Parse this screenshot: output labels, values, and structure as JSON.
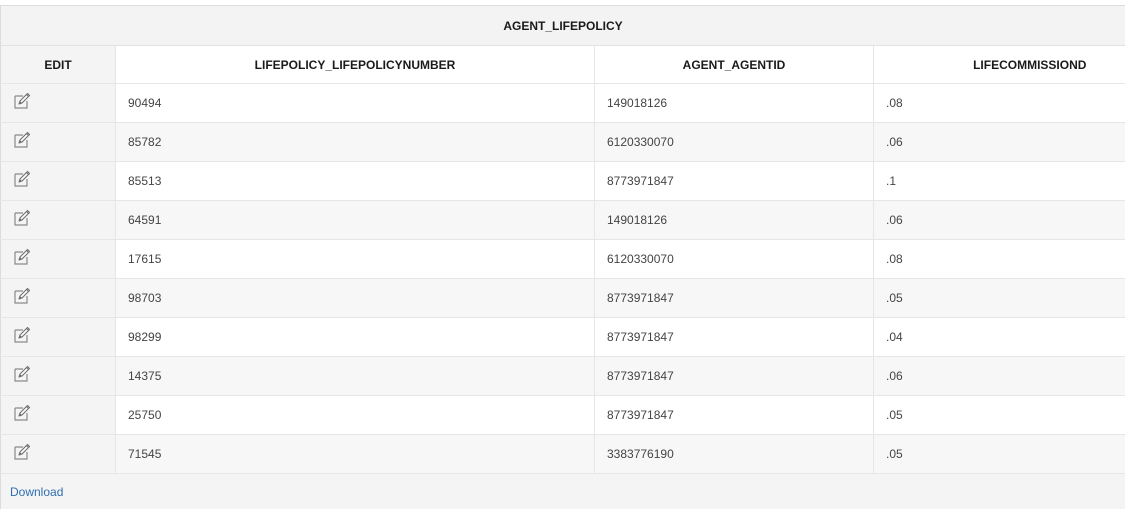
{
  "report": {
    "title": "AGENT_LIFEPOLICY",
    "columns": {
      "edit": "EDIT",
      "policy_number": "LIFEPOLICY_LIFEPOLICYNUMBER",
      "agent_id": "AGENT_AGENTID",
      "commission": "LIFECOMMISSIOND"
    },
    "edit_icon": "pencil-edit-icon",
    "rows": [
      {
        "policy_number": "90494",
        "agent_id": "149018126",
        "commission": ".08"
      },
      {
        "policy_number": "85782",
        "agent_id": "6120330070",
        "commission": ".06"
      },
      {
        "policy_number": "85513",
        "agent_id": "8773971847",
        "commission": ".1"
      },
      {
        "policy_number": "64591",
        "agent_id": "149018126",
        "commission": ".06"
      },
      {
        "policy_number": "17615",
        "agent_id": "6120330070",
        "commission": ".08"
      },
      {
        "policy_number": "98703",
        "agent_id": "8773971847",
        "commission": ".05"
      },
      {
        "policy_number": "98299",
        "agent_id": "8773971847",
        "commission": ".04"
      },
      {
        "policy_number": "14375",
        "agent_id": "8773971847",
        "commission": ".06"
      },
      {
        "policy_number": "25750",
        "agent_id": "8773971847",
        "commission": ".05"
      },
      {
        "policy_number": "71545",
        "agent_id": "3383776190",
        "commission": ".05"
      }
    ],
    "download_label": "Download"
  },
  "colors": {
    "link": "#2f6fb0",
    "row_alt": "#f7f7f7",
    "panel": "#f4f4f4"
  }
}
